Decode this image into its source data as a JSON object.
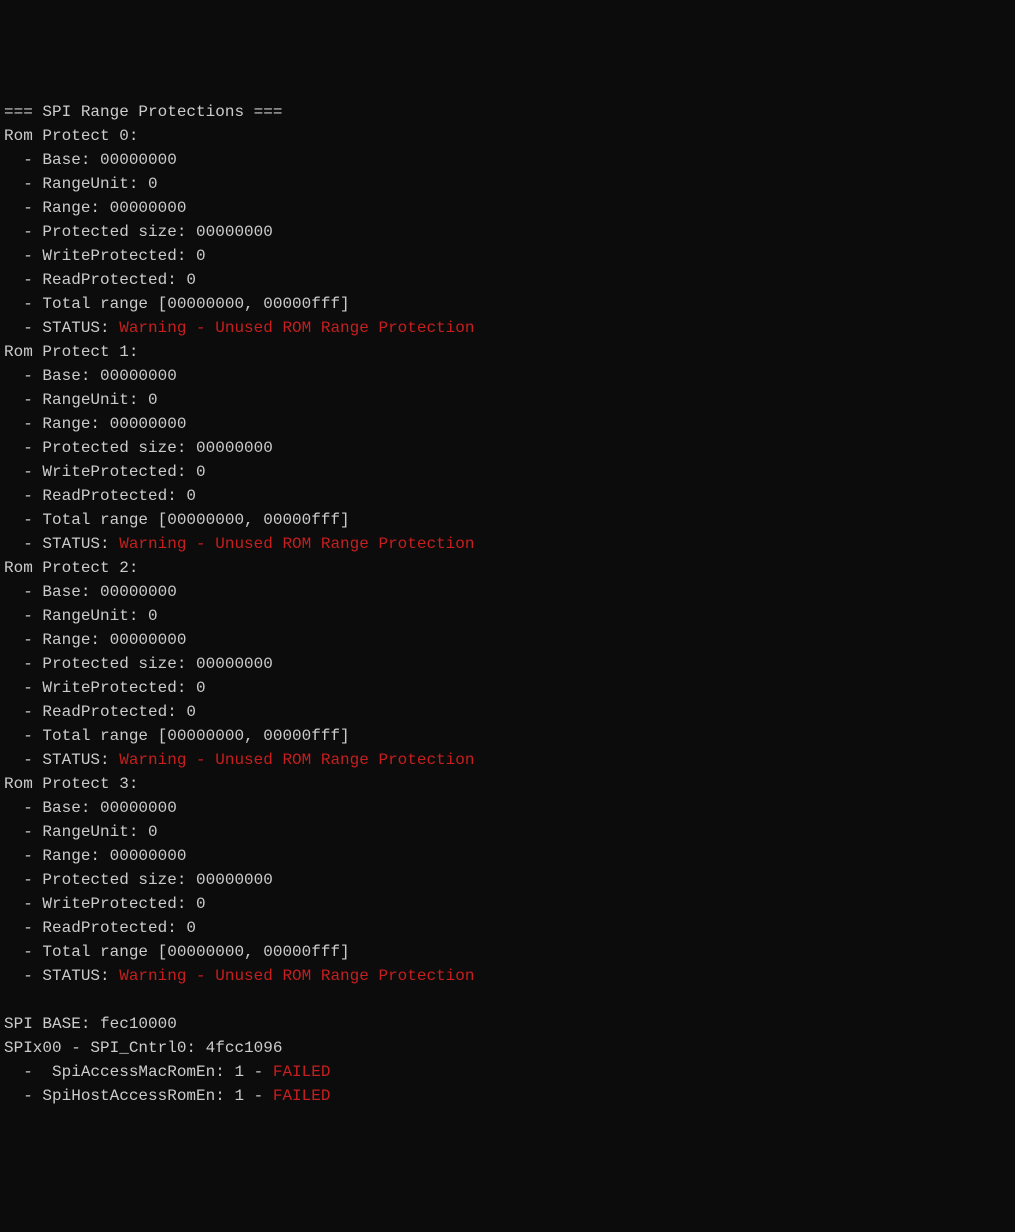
{
  "header": "=== SPI Range Protections ===",
  "romProtects": [
    {
      "title": "Rom Protect 0:",
      "base": "  - Base: 00000000",
      "rangeUnit": "  - RangeUnit: 0",
      "range": "  - Range: 00000000",
      "protectedSize": "  - Protected size: 00000000",
      "writeProtected": "  - WriteProtected: 0",
      "readProtected": "  - ReadProtected: 0",
      "totalRange": "  - Total range [00000000, 00000fff]",
      "statusLabel": "  - STATUS: ",
      "statusMsg": "Warning - Unused ROM Range Protection"
    },
    {
      "title": "Rom Protect 1:",
      "base": "  - Base: 00000000",
      "rangeUnit": "  - RangeUnit: 0",
      "range": "  - Range: 00000000",
      "protectedSize": "  - Protected size: 00000000",
      "writeProtected": "  - WriteProtected: 0",
      "readProtected": "  - ReadProtected: 0",
      "totalRange": "  - Total range [00000000, 00000fff]",
      "statusLabel": "  - STATUS: ",
      "statusMsg": "Warning - Unused ROM Range Protection"
    },
    {
      "title": "Rom Protect 2:",
      "base": "  - Base: 00000000",
      "rangeUnit": "  - RangeUnit: 0",
      "range": "  - Range: 00000000",
      "protectedSize": "  - Protected size: 00000000",
      "writeProtected": "  - WriteProtected: 0",
      "readProtected": "  - ReadProtected: 0",
      "totalRange": "  - Total range [00000000, 00000fff]",
      "statusLabel": "  - STATUS: ",
      "statusMsg": "Warning - Unused ROM Range Protection"
    },
    {
      "title": "Rom Protect 3:",
      "base": "  - Base: 00000000",
      "rangeUnit": "  - RangeUnit: 0",
      "range": "  - Range: 00000000",
      "protectedSize": "  - Protected size: 00000000",
      "writeProtected": "  - WriteProtected: 0",
      "readProtected": "  - ReadProtected: 0",
      "totalRange": "  - Total range [00000000, 00000fff]",
      "statusLabel": "  - STATUS: ",
      "statusMsg": "Warning - Unused ROM Range Protection"
    }
  ],
  "blank": " ",
  "spiBase": "SPI BASE: fec10000",
  "spix00": "SPIx00 - SPI_Cntrl0: 4fcc1096",
  "spiAccess": {
    "label": "  -  SpiAccessMacRomEn: 1 - ",
    "status": "FAILED"
  },
  "spiHost": {
    "label": "  - SpiHostAccessRomEn: 1 - ",
    "status": "FAILED"
  }
}
